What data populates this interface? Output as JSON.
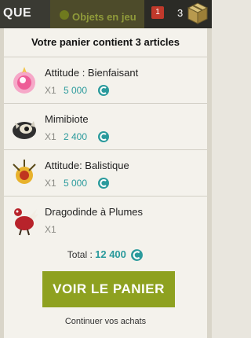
{
  "header": {
    "tab_label": "QUE",
    "ghost_link": "Objets en jeu",
    "notification_count": "1",
    "cart_count": "3"
  },
  "cart": {
    "title": "Votre panier contient 3 articles",
    "items": [
      {
        "name": "Attitude : Bienfaisant",
        "qty": "X1",
        "price": "5 000",
        "icon": "pink-orb-icon"
      },
      {
        "name": "Mimibiote",
        "qty": "X1",
        "price": "2 400",
        "icon": "mimibiote-icon"
      },
      {
        "name": "Attitude: Balistique",
        "qty": "X1",
        "price": "5 000",
        "icon": "yellow-bomb-icon"
      },
      {
        "name": "Dragodinde à Plumes",
        "qty": "X1",
        "price": "",
        "icon": "dragodinde-icon"
      }
    ],
    "total_label": "Total :",
    "total_amount": "12 400",
    "cta_label": "VOIR LE PANIER",
    "continue_label": "Continuer vos achats"
  },
  "colors": {
    "accent": "#8ea120",
    "price": "#2a9a9c",
    "badge": "#c0392b"
  }
}
